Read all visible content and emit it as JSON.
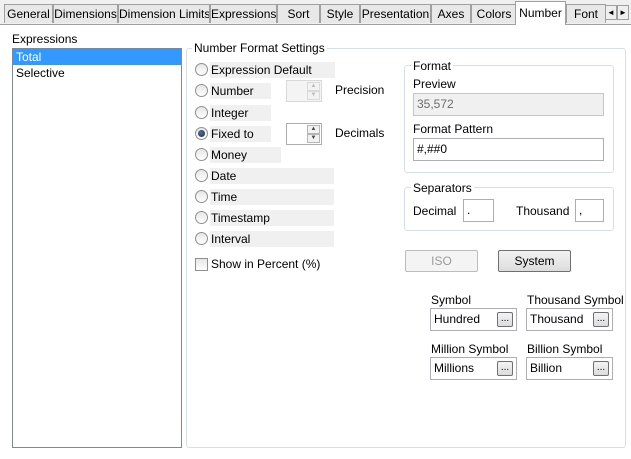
{
  "tabs": [
    {
      "label": "General"
    },
    {
      "label": "Dimensions"
    },
    {
      "label": "Dimension Limits"
    },
    {
      "label": "Expressions"
    },
    {
      "label": "Sort"
    },
    {
      "label": "Style"
    },
    {
      "label": "Presentation"
    },
    {
      "label": "Axes"
    },
    {
      "label": "Colors"
    },
    {
      "label": "Number",
      "active": true
    },
    {
      "label": "Font"
    }
  ],
  "tab_scroll": {
    "left": "◄",
    "right": "►"
  },
  "expressions": {
    "title": "Expressions",
    "items": [
      "Total",
      "Selective"
    ],
    "selected": "Total"
  },
  "number_format": {
    "title": "Number Format Settings",
    "options": [
      "Expression Default",
      "Number",
      "Integer",
      "Fixed to",
      "Money",
      "Date",
      "Time",
      "Timestamp",
      "Interval"
    ],
    "selected": "Fixed to",
    "precision_label": "Precision",
    "decimals_label": "Decimals",
    "precision_value": "",
    "decimals_value": "",
    "show_in_percent": "Show in Percent (%)",
    "show_in_percent_checked": false
  },
  "format": {
    "title": "Format",
    "preview_label": "Preview",
    "preview_value": "35,572",
    "pattern_label": "Format Pattern",
    "pattern_value": "#,##0"
  },
  "separators": {
    "title": "Separators",
    "decimal_label": "Decimal",
    "decimal_value": ".",
    "thousand_label": "Thousand",
    "thousand_value": ","
  },
  "buttons": {
    "iso": "ISO",
    "system": "System"
  },
  "symbols": {
    "symbol_label": "Symbol",
    "symbol_value": "Hundred",
    "thousand_label": "Thousand Symbol",
    "thousand_value": "Thousand",
    "million_label": "Million Symbol",
    "million_value": "Millions",
    "billion_label": "Billion Symbol",
    "billion_value": "Billion",
    "ellipsis": "..."
  },
  "spin_up": "▲",
  "spin_down": "▼"
}
